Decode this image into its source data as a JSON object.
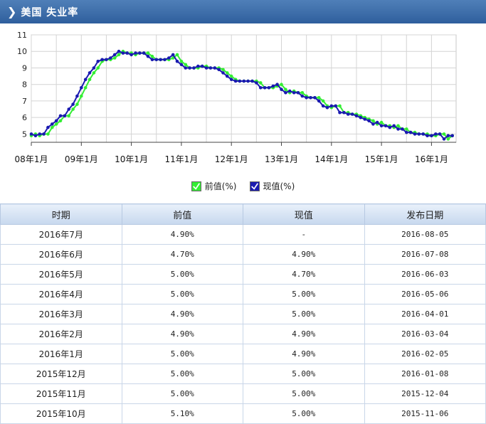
{
  "header": {
    "title": "美国 失业率",
    "chevron_icon": "chevron-right-icon"
  },
  "chart_data": {
    "type": "line",
    "x_tick_labels": [
      "08年1月",
      "09年1月",
      "10年1月",
      "11年1月",
      "12年1月",
      "13年1月",
      "14年1月",
      "15年1月",
      "16年1月"
    ],
    "y_ticks": [
      5,
      6,
      7,
      8,
      9,
      10,
      11
    ],
    "ylim": [
      4.5,
      11
    ],
    "grid": true,
    "series": [
      {
        "name": "前值(%)",
        "color": "#33ee33",
        "values": [
          4.9,
          5.0,
          4.9,
          5.0,
          5.0,
          5.4,
          5.6,
          5.8,
          6.1,
          6.1,
          6.5,
          6.8,
          7.3,
          7.8,
          8.3,
          8.7,
          9.0,
          9.4,
          9.5,
          9.5,
          9.6,
          9.8,
          10.0,
          9.9,
          9.9,
          9.8,
          9.9,
          9.9,
          9.9,
          9.7,
          9.5,
          9.5,
          9.5,
          9.5,
          9.6,
          9.8,
          9.4,
          9.2,
          9.0,
          9.0,
          9.0,
          9.1,
          9.1,
          9.0,
          9.0,
          9.0,
          8.9,
          8.7,
          8.5,
          8.3,
          8.2,
          8.2,
          8.2,
          8.2,
          8.2,
          8.1,
          7.8,
          7.8,
          7.8,
          7.9,
          8.0,
          7.7,
          7.5,
          7.6,
          7.5,
          7.5,
          7.3,
          7.2,
          7.2,
          7.2,
          7.0,
          6.7,
          6.6,
          6.7,
          6.7,
          6.3,
          6.3,
          6.2,
          6.2,
          6.1,
          6.0,
          5.9,
          5.8,
          5.6,
          5.7,
          5.5,
          5.5,
          5.4,
          5.5,
          5.3,
          5.3,
          5.1,
          5.1,
          5.0,
          5.0,
          5.0,
          4.9,
          4.9,
          5.0,
          5.0,
          4.7,
          4.9
        ]
      },
      {
        "name": "现值(%)",
        "color": "#1a1ab0",
        "values": [
          5.0,
          4.9,
          5.0,
          5.0,
          5.4,
          5.6,
          5.8,
          6.1,
          6.1,
          6.5,
          6.8,
          7.3,
          7.8,
          8.3,
          8.7,
          9.0,
          9.4,
          9.5,
          9.5,
          9.6,
          9.8,
          10.0,
          9.9,
          9.9,
          9.8,
          9.9,
          9.9,
          9.9,
          9.7,
          9.5,
          9.5,
          9.5,
          9.5,
          9.6,
          9.8,
          9.4,
          9.2,
          9.0,
          9.0,
          9.0,
          9.1,
          9.1,
          9.0,
          9.0,
          9.0,
          8.9,
          8.7,
          8.5,
          8.3,
          8.2,
          8.2,
          8.2,
          8.2,
          8.2,
          8.1,
          7.8,
          7.8,
          7.8,
          7.9,
          8.0,
          7.7,
          7.5,
          7.6,
          7.5,
          7.5,
          7.3,
          7.2,
          7.2,
          7.2,
          7.0,
          6.7,
          6.6,
          6.7,
          6.7,
          6.3,
          6.3,
          6.2,
          6.2,
          6.1,
          6.0,
          5.9,
          5.8,
          5.6,
          5.7,
          5.5,
          5.5,
          5.4,
          5.5,
          5.3,
          5.3,
          5.1,
          5.1,
          5.0,
          5.0,
          5.0,
          4.9,
          4.9,
          5.0,
          5.0,
          4.7,
          4.9,
          4.9
        ]
      }
    ]
  },
  "legend": {
    "prev_label": "前值(%)",
    "curr_label": "现值(%)"
  },
  "table": {
    "headers": [
      "时期",
      "前值",
      "现值",
      "发布日期"
    ],
    "rows": [
      [
        "2016年7月",
        "4.90%",
        "-",
        "2016-08-05"
      ],
      [
        "2016年6月",
        "4.70%",
        "4.90%",
        "2016-07-08"
      ],
      [
        "2016年5月",
        "5.00%",
        "4.70%",
        "2016-06-03"
      ],
      [
        "2016年4月",
        "5.00%",
        "5.00%",
        "2016-05-06"
      ],
      [
        "2016年3月",
        "4.90%",
        "5.00%",
        "2016-04-01"
      ],
      [
        "2016年2月",
        "4.90%",
        "4.90%",
        "2016-03-04"
      ],
      [
        "2016年1月",
        "5.00%",
        "4.90%",
        "2016-02-05"
      ],
      [
        "2015年12月",
        "5.00%",
        "5.00%",
        "2016-01-08"
      ],
      [
        "2015年11月",
        "5.00%",
        "5.00%",
        "2015-12-04"
      ],
      [
        "2015年10月",
        "5.10%",
        "5.00%",
        "2015-11-06"
      ]
    ]
  }
}
